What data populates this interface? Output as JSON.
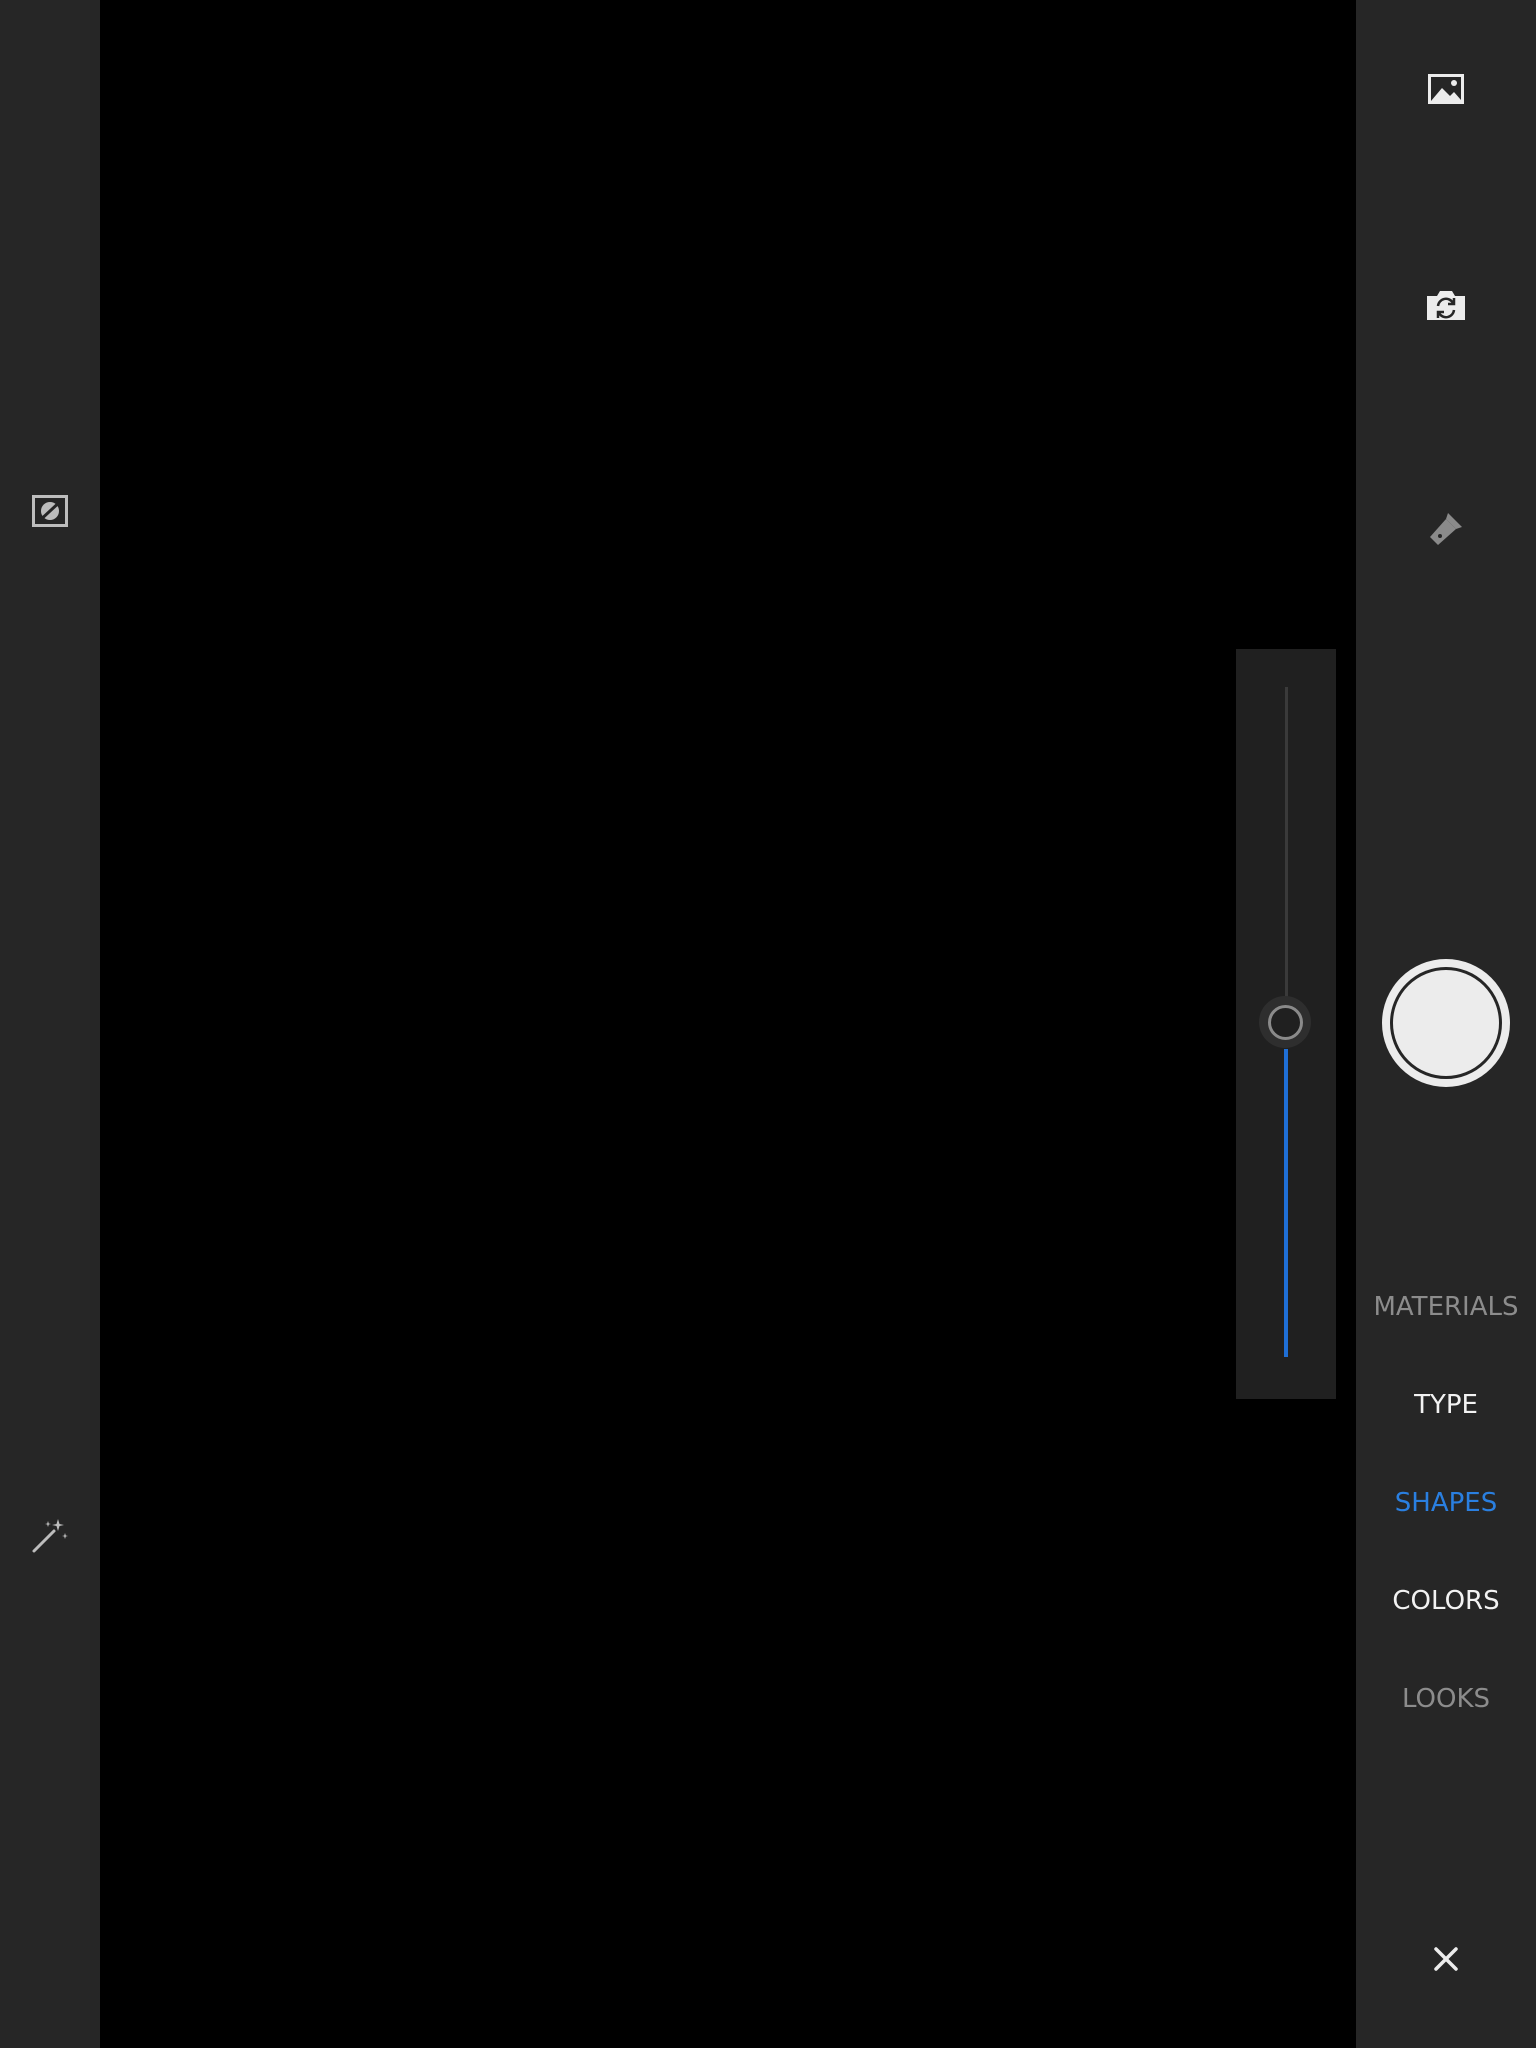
{
  "colors": {
    "background": "#000000",
    "rail": "#262626",
    "accent": "#2a7fe0",
    "text": "#f2f2f2",
    "text_dim": "#8c8c8c"
  },
  "left_toolbar": {
    "icons": [
      "no-filter-icon",
      "magic-wand-icon"
    ]
  },
  "right_toolbar": {
    "icons": [
      "gallery-icon",
      "switch-camera-icon",
      "flashlight-icon",
      "close-icon"
    ]
  },
  "zoom_slider": {
    "level": 0.5
  },
  "shutter": {
    "icon": "shutter-button"
  },
  "modes": [
    {
      "label": "MATERIALS",
      "state": "dim"
    },
    {
      "label": "TYPE",
      "state": "normal"
    },
    {
      "label": "SHAPES",
      "state": "active"
    },
    {
      "label": "COLORS",
      "state": "normal"
    },
    {
      "label": "LOOKS",
      "state": "dim"
    }
  ]
}
